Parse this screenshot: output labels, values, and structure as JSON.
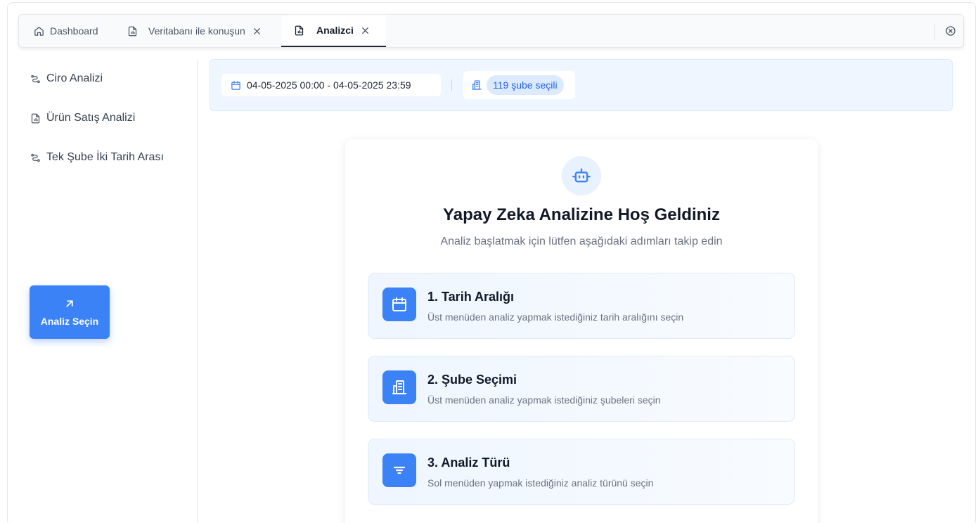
{
  "tabs": [
    {
      "label": "Dashboard",
      "icon": "home-icon",
      "closable": false,
      "active": false
    },
    {
      "label": "Veritabanı ile konuşun",
      "icon": "file-chart-icon",
      "closable": true,
      "active": false
    },
    {
      "label": "Analizci",
      "icon": "file-chart-icon",
      "closable": true,
      "active": true
    }
  ],
  "sidebar": {
    "items": [
      {
        "label": "Ciro Analizi",
        "icon": "trend-icon"
      },
      {
        "label": "Ürün Satış Analizi",
        "icon": "file-chart-icon"
      },
      {
        "label": "Tek Şube İki Tarih Arası",
        "icon": "trend-icon"
      }
    ],
    "action_button": {
      "label": "Analiz Seçin",
      "icon": "arrow-up-right-icon"
    }
  },
  "filters": {
    "date_range": "04-05-2025 00:00 - 04-05-2025 23:59",
    "branches_badge": "119 şube seçili"
  },
  "welcome": {
    "title": "Yapay Zeka Analizine Hoş Geldiniz",
    "subtitle": "Analiz başlatmak için lütfen aşağıdaki adımları takip edin",
    "steps": [
      {
        "title": "1. Tarih Aralığı",
        "desc": "Üst menüden analiz yapmak istediğiniz tarih aralığını seçin",
        "icon": "calendar-icon"
      },
      {
        "title": "2. Şube Seçimi",
        "desc": "Üst menüden analiz yapmak istediğiniz şubeleri seçin",
        "icon": "building-icon"
      },
      {
        "title": "3. Analiz Türü",
        "desc": "Sol menüden yapmak istediğiniz analiz türünü seçin",
        "icon": "filter-icon"
      }
    ]
  },
  "colors": {
    "accent": "#3b82f6",
    "accent_light": "#dbeafe",
    "text": "#111827",
    "muted": "#6b7280"
  }
}
